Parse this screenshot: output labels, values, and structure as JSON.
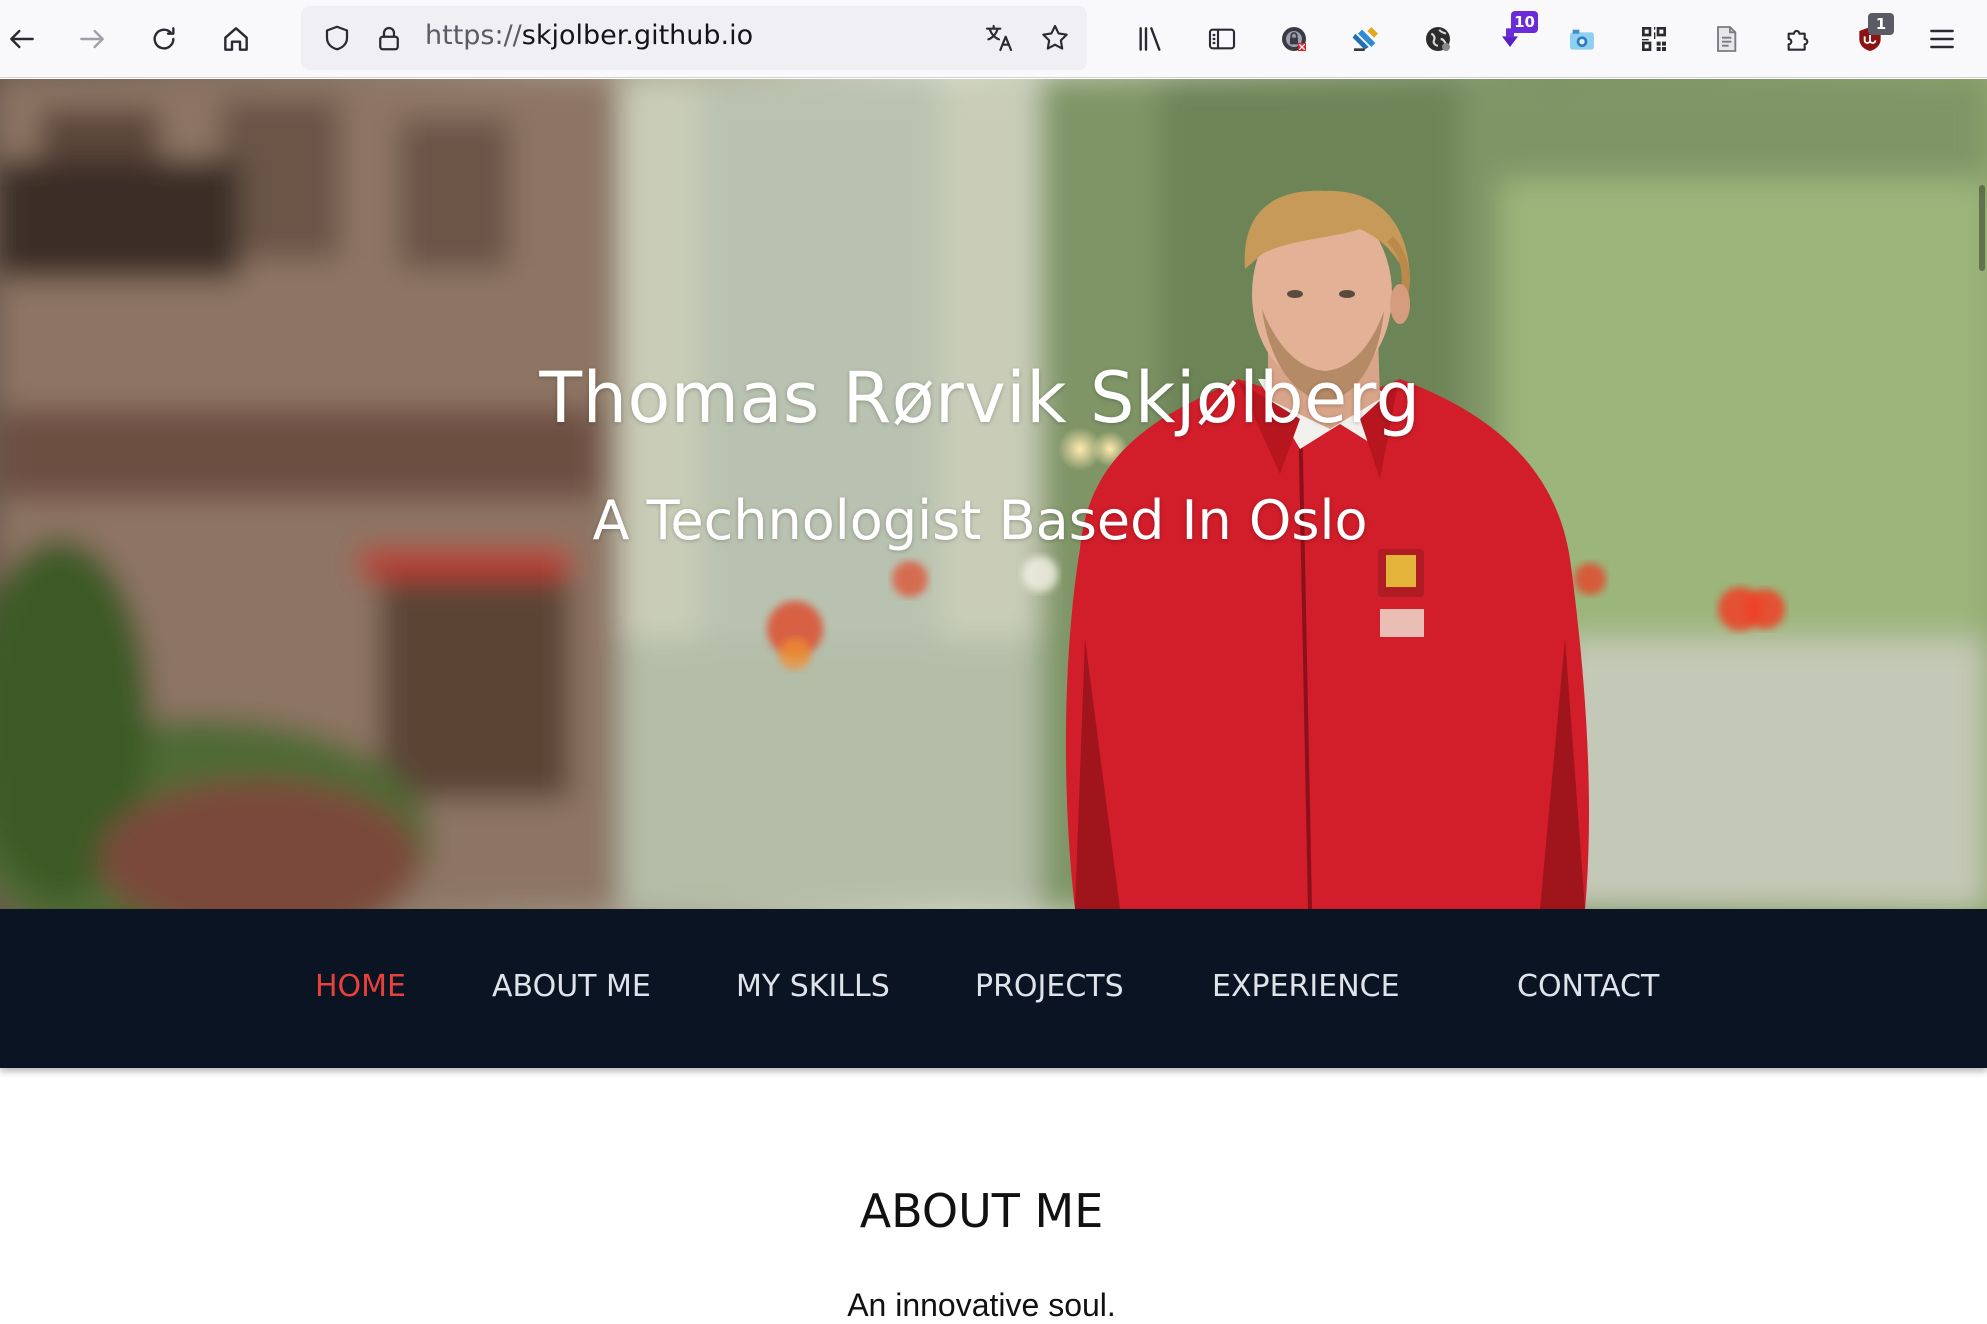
{
  "browser": {
    "url_scheme": "https://",
    "url_host": "skjolber.github.io",
    "extension_badges": {
      "downloads_count": "10",
      "ublock_count": "1"
    },
    "colors": {
      "badge_purple": "#6a2bd9",
      "badge_gray": "#5b5b66"
    }
  },
  "hero": {
    "name": "Thomas Rørvik Skjølberg",
    "tagline": "A Technologist Based In Oslo"
  },
  "nav": {
    "items": [
      {
        "label": "HOME",
        "active": true
      },
      {
        "label": "ABOUT ME",
        "active": false
      },
      {
        "label": "MY SKILLS",
        "active": false
      },
      {
        "label": "PROJECTS",
        "active": false
      },
      {
        "label": "EXPERIENCE",
        "active": false
      },
      {
        "label": "CONTACT",
        "active": false
      }
    ],
    "colors": {
      "background": "#0b1423",
      "active": "#e8403a",
      "text": "#dfe3ea"
    }
  },
  "about": {
    "title": "ABOUT ME",
    "subtitle": "An innovative soul."
  }
}
